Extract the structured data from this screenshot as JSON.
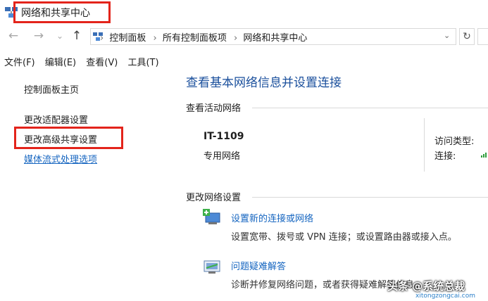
{
  "window": {
    "title": "网络和共享中心"
  },
  "nav": {
    "back_icon": "←",
    "forward_icon": "→",
    "recent_icon": "⌄",
    "up_icon": "↑",
    "refresh_icon": "↻"
  },
  "breadcrumb": [
    "控制面板",
    "所有控制面板项",
    "网络和共享中心"
  ],
  "menu": [
    "文件(F)",
    "编辑(E)",
    "查看(V)",
    "工具(T)"
  ],
  "sidebar": {
    "home": "控制面板主页",
    "items": [
      "更改适配器设置",
      "更改高级共享设置"
    ],
    "see_also": "媒体流式处理选项"
  },
  "main": {
    "heading": "查看基本网络信息并设置连接",
    "active_section": "查看活动网络",
    "network_name": "IT-1109",
    "network_type": "专用网络",
    "access_type_label": "访问类型:",
    "connections_label": "连接:",
    "change_section": "更改网络设置",
    "tasks": [
      {
        "link": "设置新的连接或网络",
        "desc": "设置宽带、拨号或 VPN 连接；或设置路由器或接入点。"
      },
      {
        "link": "问题疑难解答",
        "desc": "诊断并修复网络问题，或者获得疑难解答信息。"
      }
    ]
  },
  "watermark": {
    "text": "头条 @系统总裁",
    "url": "xitongzongcai.com"
  },
  "colors": {
    "highlight": "#e3241b",
    "link": "#1565c0",
    "heading": "#1a4f9c"
  }
}
